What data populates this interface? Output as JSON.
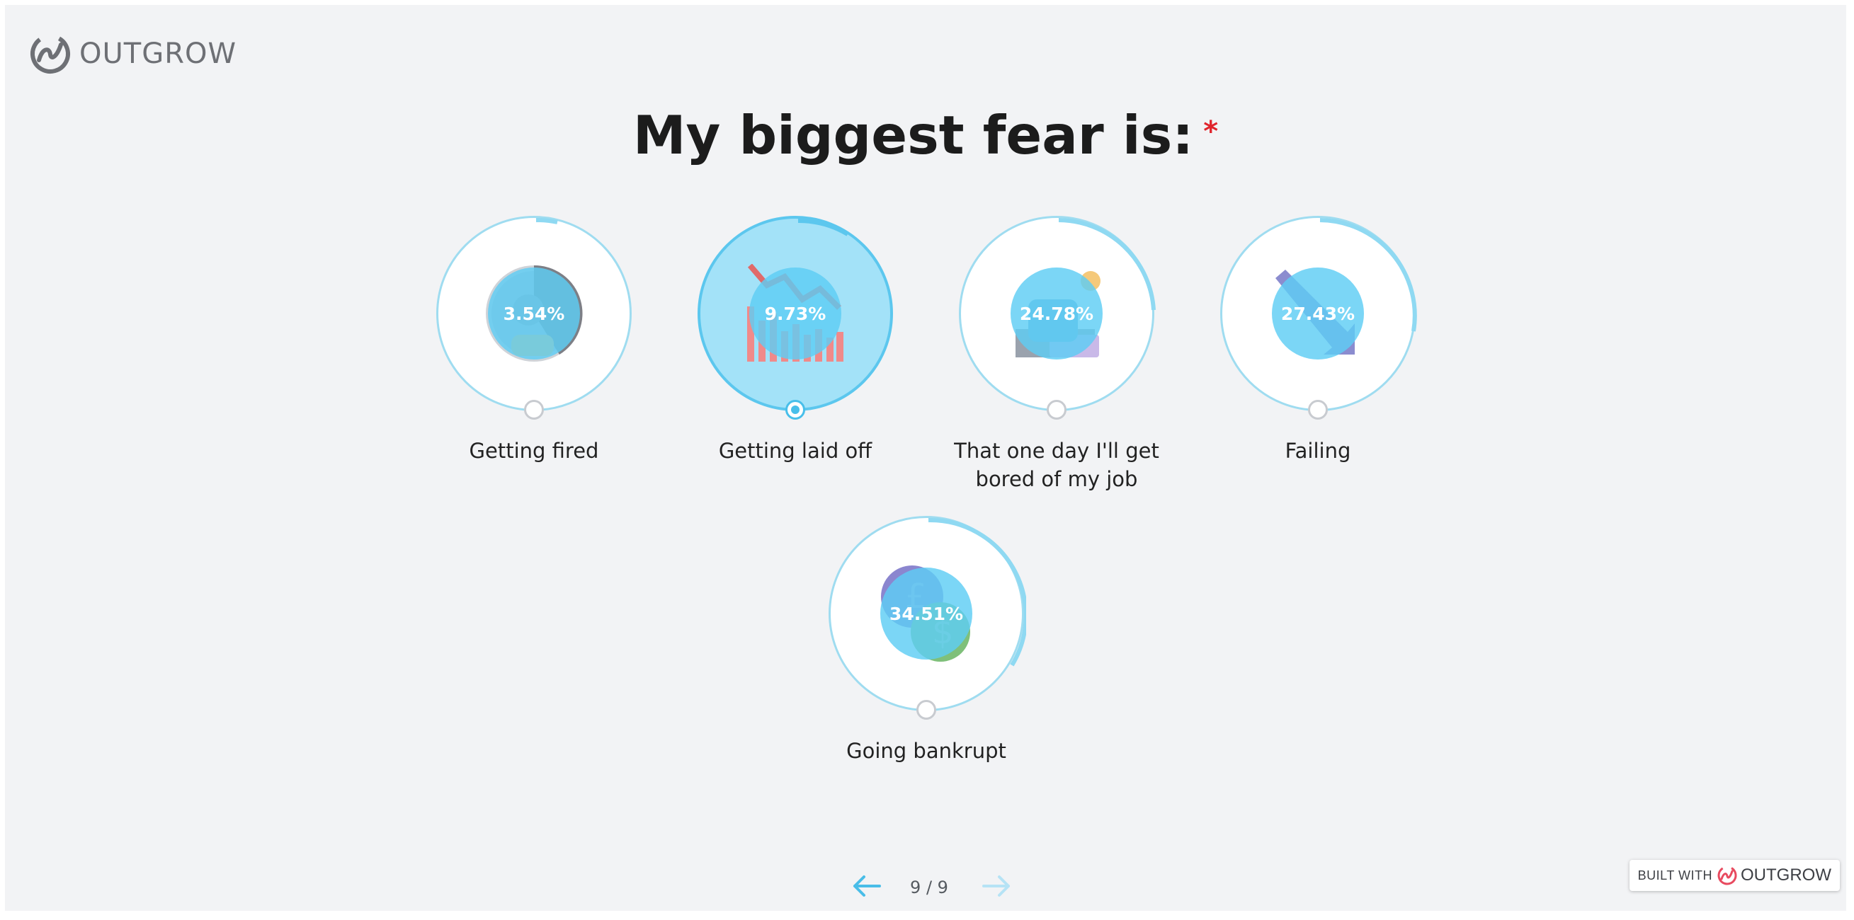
{
  "brand": {
    "name": "OUTGROW"
  },
  "question": {
    "text": "My biggest fear is:",
    "required_marker": "*"
  },
  "options": [
    {
      "label": "Getting fired",
      "percent": "3.54%",
      "selected": false,
      "icon": "person-icon"
    },
    {
      "label": "Getting laid off",
      "percent": "9.73%",
      "selected": true,
      "icon": "declining-bar-chart-icon"
    },
    {
      "label": "That one day I'll get bored of my job",
      "percent": "24.78%",
      "selected": false,
      "icon": "sleeping-at-desk-icon"
    },
    {
      "label": "Failing",
      "percent": "27.43%",
      "selected": false,
      "icon": "downward-arrow-icon"
    },
    {
      "label": "Going bankrupt",
      "percent": "34.51%",
      "selected": false,
      "icon": "coins-icon"
    }
  ],
  "navigation": {
    "page_indicator": "9 / 9",
    "prev_icon": "arrow-left-icon",
    "next_icon": "arrow-right-icon"
  },
  "footer": {
    "built_with": "BUILT WITH",
    "brand": "OUTGROW"
  },
  "colors": {
    "accent": "#5cc7ee",
    "ring": "#9fdcf0",
    "selected_fill": "#a3e2f8",
    "required": "#e0242c",
    "brand_red": "#e84a5f"
  }
}
